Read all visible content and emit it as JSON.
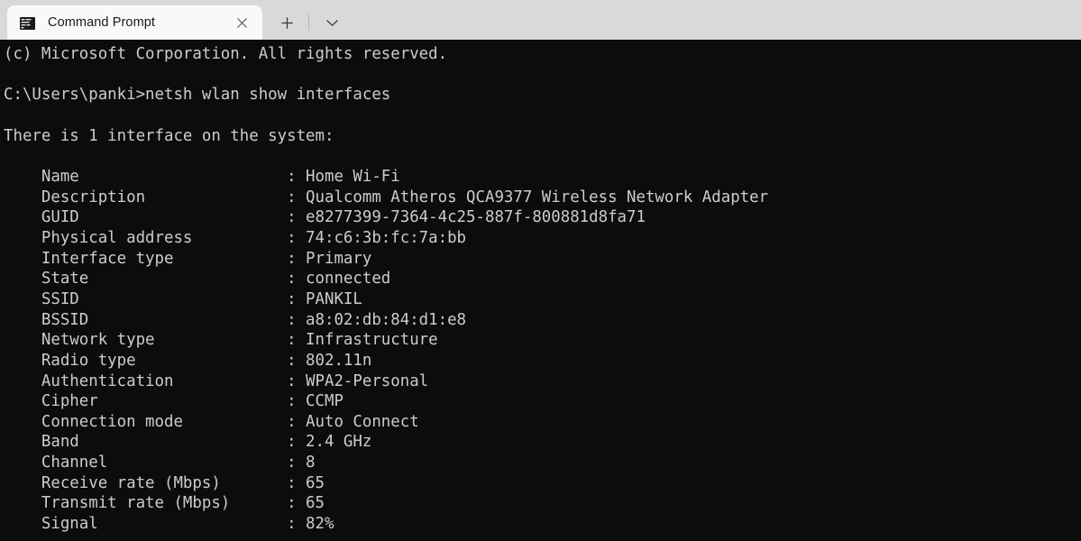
{
  "window": {
    "title": "Command Prompt",
    "titlebar_bg": "#d9d9d9",
    "tab_bg": "#f9f9f9",
    "terminal_bg": "#0c0c0c",
    "terminal_fg": "#cccccc"
  },
  "tab": {
    "label": "Command Prompt",
    "icon": "console-icon",
    "close_label": "Close tab"
  },
  "tabbar": {
    "new_tab_label": "New tab",
    "dropdown_label": "Open new tab dropdown"
  },
  "terminal": {
    "header_lines": [
      "(c) Microsoft Corporation. All rights reserved.",
      "",
      "C:\\Users\\panki>netsh wlan show interfaces",
      "",
      "There is 1 interface on the system:",
      ""
    ],
    "prompt_path": "C:\\Users\\panki",
    "command": "netsh wlan show interfaces",
    "copyright": "(c) Microsoft Corporation. All rights reserved.",
    "summary": "There is 1 interface on the system:",
    "label_indent": 4,
    "label_width": 26,
    "properties": [
      {
        "label": "Name",
        "value": "Home Wi-Fi"
      },
      {
        "label": "Description",
        "value": "Qualcomm Atheros QCA9377 Wireless Network Adapter"
      },
      {
        "label": "GUID",
        "value": "e8277399-7364-4c25-887f-800881d8fa71"
      },
      {
        "label": "Physical address",
        "value": "74:c6:3b:fc:7a:bb"
      },
      {
        "label": "Interface type",
        "value": "Primary"
      },
      {
        "label": "State",
        "value": "connected"
      },
      {
        "label": "SSID",
        "value": "PANKIL"
      },
      {
        "label": "BSSID",
        "value": "a8:02:db:84:d1:e8"
      },
      {
        "label": "Network type",
        "value": "Infrastructure"
      },
      {
        "label": "Radio type",
        "value": "802.11n"
      },
      {
        "label": "Authentication",
        "value": "WPA2-Personal"
      },
      {
        "label": "Cipher",
        "value": "CCMP"
      },
      {
        "label": "Connection mode",
        "value": "Auto Connect"
      },
      {
        "label": "Band",
        "value": "2.4 GHz"
      },
      {
        "label": "Channel",
        "value": "8"
      },
      {
        "label": "Receive rate (Mbps)",
        "value": "65"
      },
      {
        "label": "Transmit rate (Mbps)",
        "value": "65"
      },
      {
        "label": "Signal",
        "value": "82%"
      }
    ]
  }
}
